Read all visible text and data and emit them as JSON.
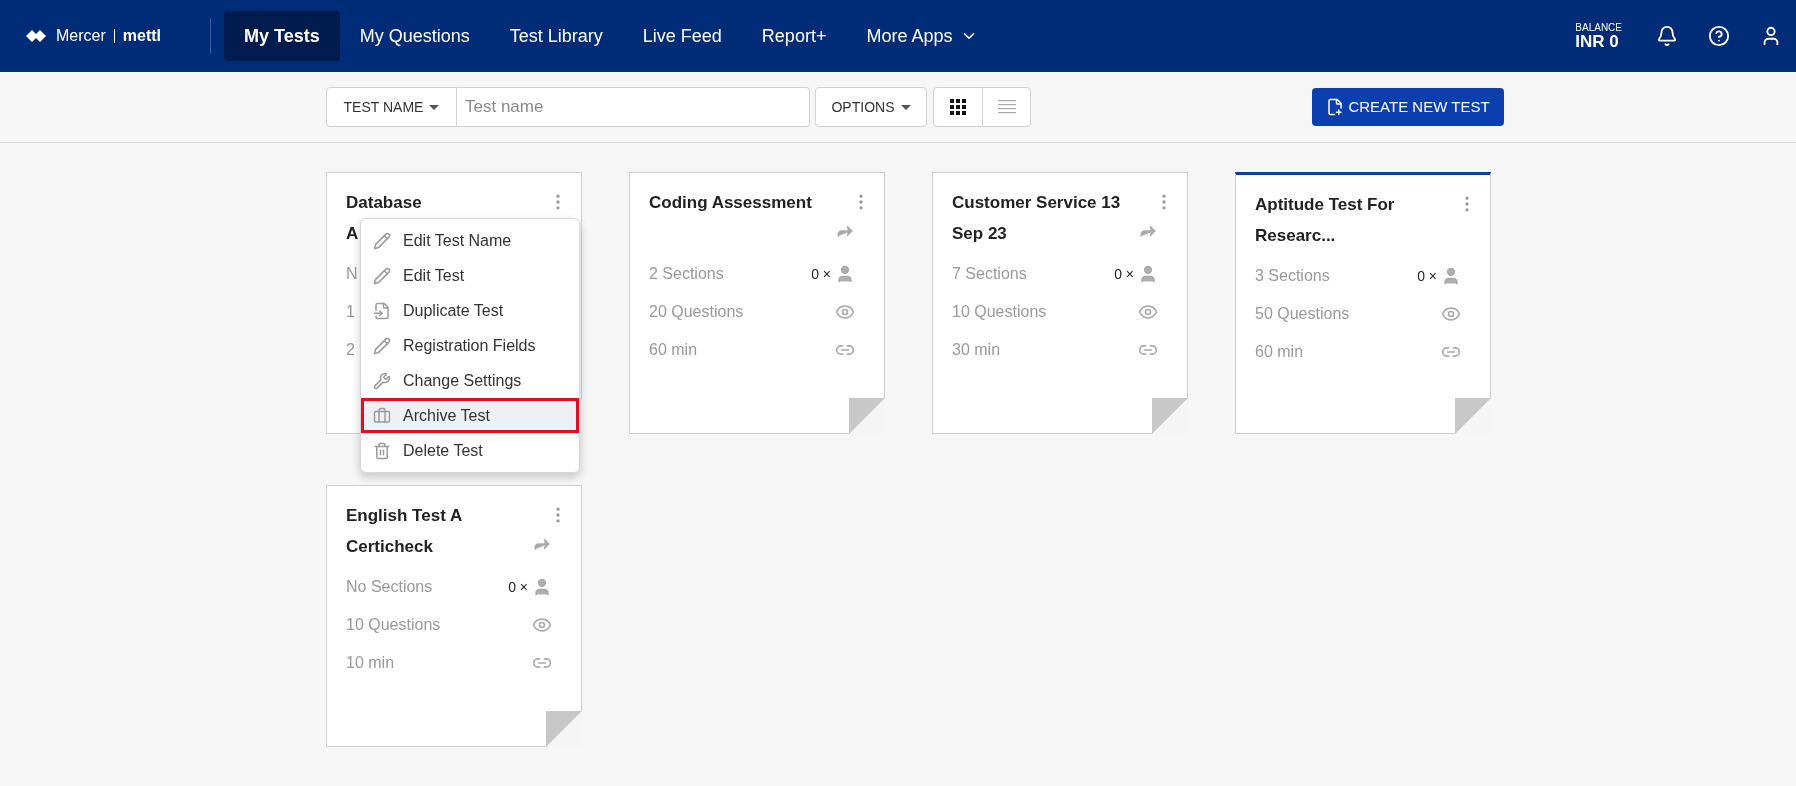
{
  "header": {
    "logo": {
      "brand": "Mercer",
      "product": "mettl"
    },
    "nav": [
      {
        "label": "My Tests",
        "selected": true
      },
      {
        "label": "My Questions",
        "selected": false
      },
      {
        "label": "Test Library",
        "selected": false
      },
      {
        "label": "Live Feed",
        "selected": false
      },
      {
        "label": "Report+",
        "selected": false
      },
      {
        "label": "More Apps",
        "selected": false,
        "dropdown": true
      }
    ],
    "balance": {
      "label": "BALANCE",
      "value": "INR 0"
    }
  },
  "toolbar": {
    "filter": "TEST NAME",
    "search": {
      "placeholder": "Test name"
    },
    "options": "OPTIONS",
    "views": [
      {
        "kind": "grid",
        "selected": true
      },
      {
        "kind": "list",
        "selected": false
      }
    ],
    "create_button": "CREATE NEW TEST"
  },
  "cards": [
    {
      "title_lines": [
        "Database",
        "A"
      ],
      "highlighted": false,
      "rows": [
        {
          "text": "N"
        },
        {
          "text": "1"
        },
        {
          "text": "2"
        }
      ]
    },
    {
      "title_lines": [
        "Coding Assessment"
      ],
      "share": true,
      "highlighted": false,
      "rows": [
        {
          "kind": "sections",
          "text": "2 Sections",
          "count": "0 ×"
        },
        {
          "kind": "questions",
          "text": "20 Questions"
        },
        {
          "kind": "duration",
          "text": "60 min"
        }
      ]
    },
    {
      "title_lines": [
        "Customer Service 13",
        "Sep 23"
      ],
      "share": true,
      "highlighted": false,
      "rows": [
        {
          "kind": "sections",
          "text": "7 Sections",
          "count": "0 ×"
        },
        {
          "kind": "questions",
          "text": "10 Questions"
        },
        {
          "kind": "duration",
          "text": "30 min"
        }
      ]
    },
    {
      "title_lines": [
        "Aptitude Test For",
        "Researc..."
      ],
      "share": false,
      "highlighted": true,
      "rows": [
        {
          "kind": "sections",
          "text": "3 Sections",
          "count": "0 ×"
        },
        {
          "kind": "questions",
          "text": "50 Questions"
        },
        {
          "kind": "duration",
          "text": "60 min"
        }
      ]
    },
    {
      "title_lines": [
        "English Test A",
        "Certicheck"
      ],
      "share": true,
      "highlighted": false,
      "rows": [
        {
          "kind": "sections",
          "text": "No Sections",
          "count": "0 ×"
        },
        {
          "kind": "questions",
          "text": "10 Questions"
        },
        {
          "kind": "duration",
          "text": "10 min"
        }
      ]
    }
  ],
  "menu": {
    "items": [
      {
        "label": "Edit Test Name",
        "kind": "pencil",
        "highlighted": false
      },
      {
        "label": "Edit Test",
        "kind": "pencil",
        "highlighted": false
      },
      {
        "label": "Duplicate Test",
        "kind": "duplicate",
        "highlighted": false
      },
      {
        "label": "Registration Fields",
        "kind": "pencil",
        "highlighted": false
      },
      {
        "label": "Change Settings",
        "kind": "settings",
        "highlighted": false
      },
      {
        "label": "Archive Test",
        "kind": "archive",
        "highlighted": true
      },
      {
        "label": "Delete Test",
        "kind": "trash",
        "highlighted": false
      }
    ]
  }
}
